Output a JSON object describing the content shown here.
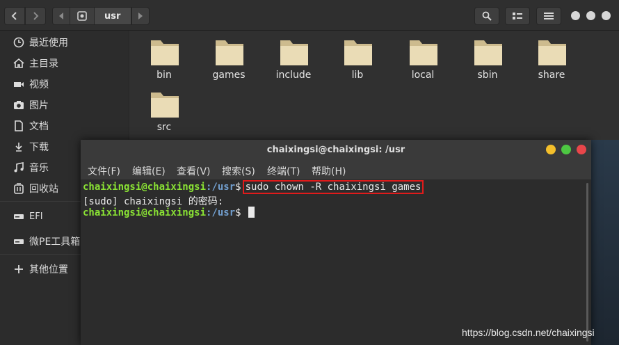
{
  "file_manager": {
    "path_segment": "usr",
    "sidebar": [
      {
        "label": "最近使用",
        "icon": "clock-icon"
      },
      {
        "label": "主目录",
        "icon": "home-icon"
      },
      {
        "label": "视频",
        "icon": "video-icon"
      },
      {
        "label": "图片",
        "icon": "camera-icon"
      },
      {
        "label": "文档",
        "icon": "document-icon"
      },
      {
        "label": "下载",
        "icon": "download-icon"
      },
      {
        "label": "音乐",
        "icon": "music-icon"
      },
      {
        "label": "回收站",
        "icon": "trash-icon"
      },
      {
        "label": "EFI",
        "icon": "drive-icon"
      },
      {
        "label": "微PE工具箱",
        "icon": "drive-icon"
      },
      {
        "label": "其他位置",
        "icon": "plus-icon"
      }
    ],
    "folders": [
      "bin",
      "games",
      "include",
      "lib",
      "local",
      "sbin",
      "share",
      "src"
    ]
  },
  "terminal": {
    "title": "chaixingsi@chaixingsi: /usr",
    "menu": [
      "文件(F)",
      "编辑(E)",
      "查看(V)",
      "搜索(S)",
      "终端(T)",
      "帮助(H)"
    ],
    "lines": [
      {
        "user": "chaixingsi@chaixingsi",
        "path": ":/usr",
        "sym": "$",
        "cmd": "sudo chown -R chaixingsi games"
      },
      {
        "text": "[sudo] chaixingsi 的密码:"
      },
      {
        "user": "chaixingsi@chaixingsi",
        "path": ":/usr",
        "sym": "$"
      }
    ]
  },
  "watermark": "https://blog.csdn.net/chaixingsi",
  "colors": {
    "prompt_user": "#8ae234",
    "prompt_path": "#729fcf",
    "highlight_box": "#e01b1b",
    "folder": "#e8d8b0"
  }
}
